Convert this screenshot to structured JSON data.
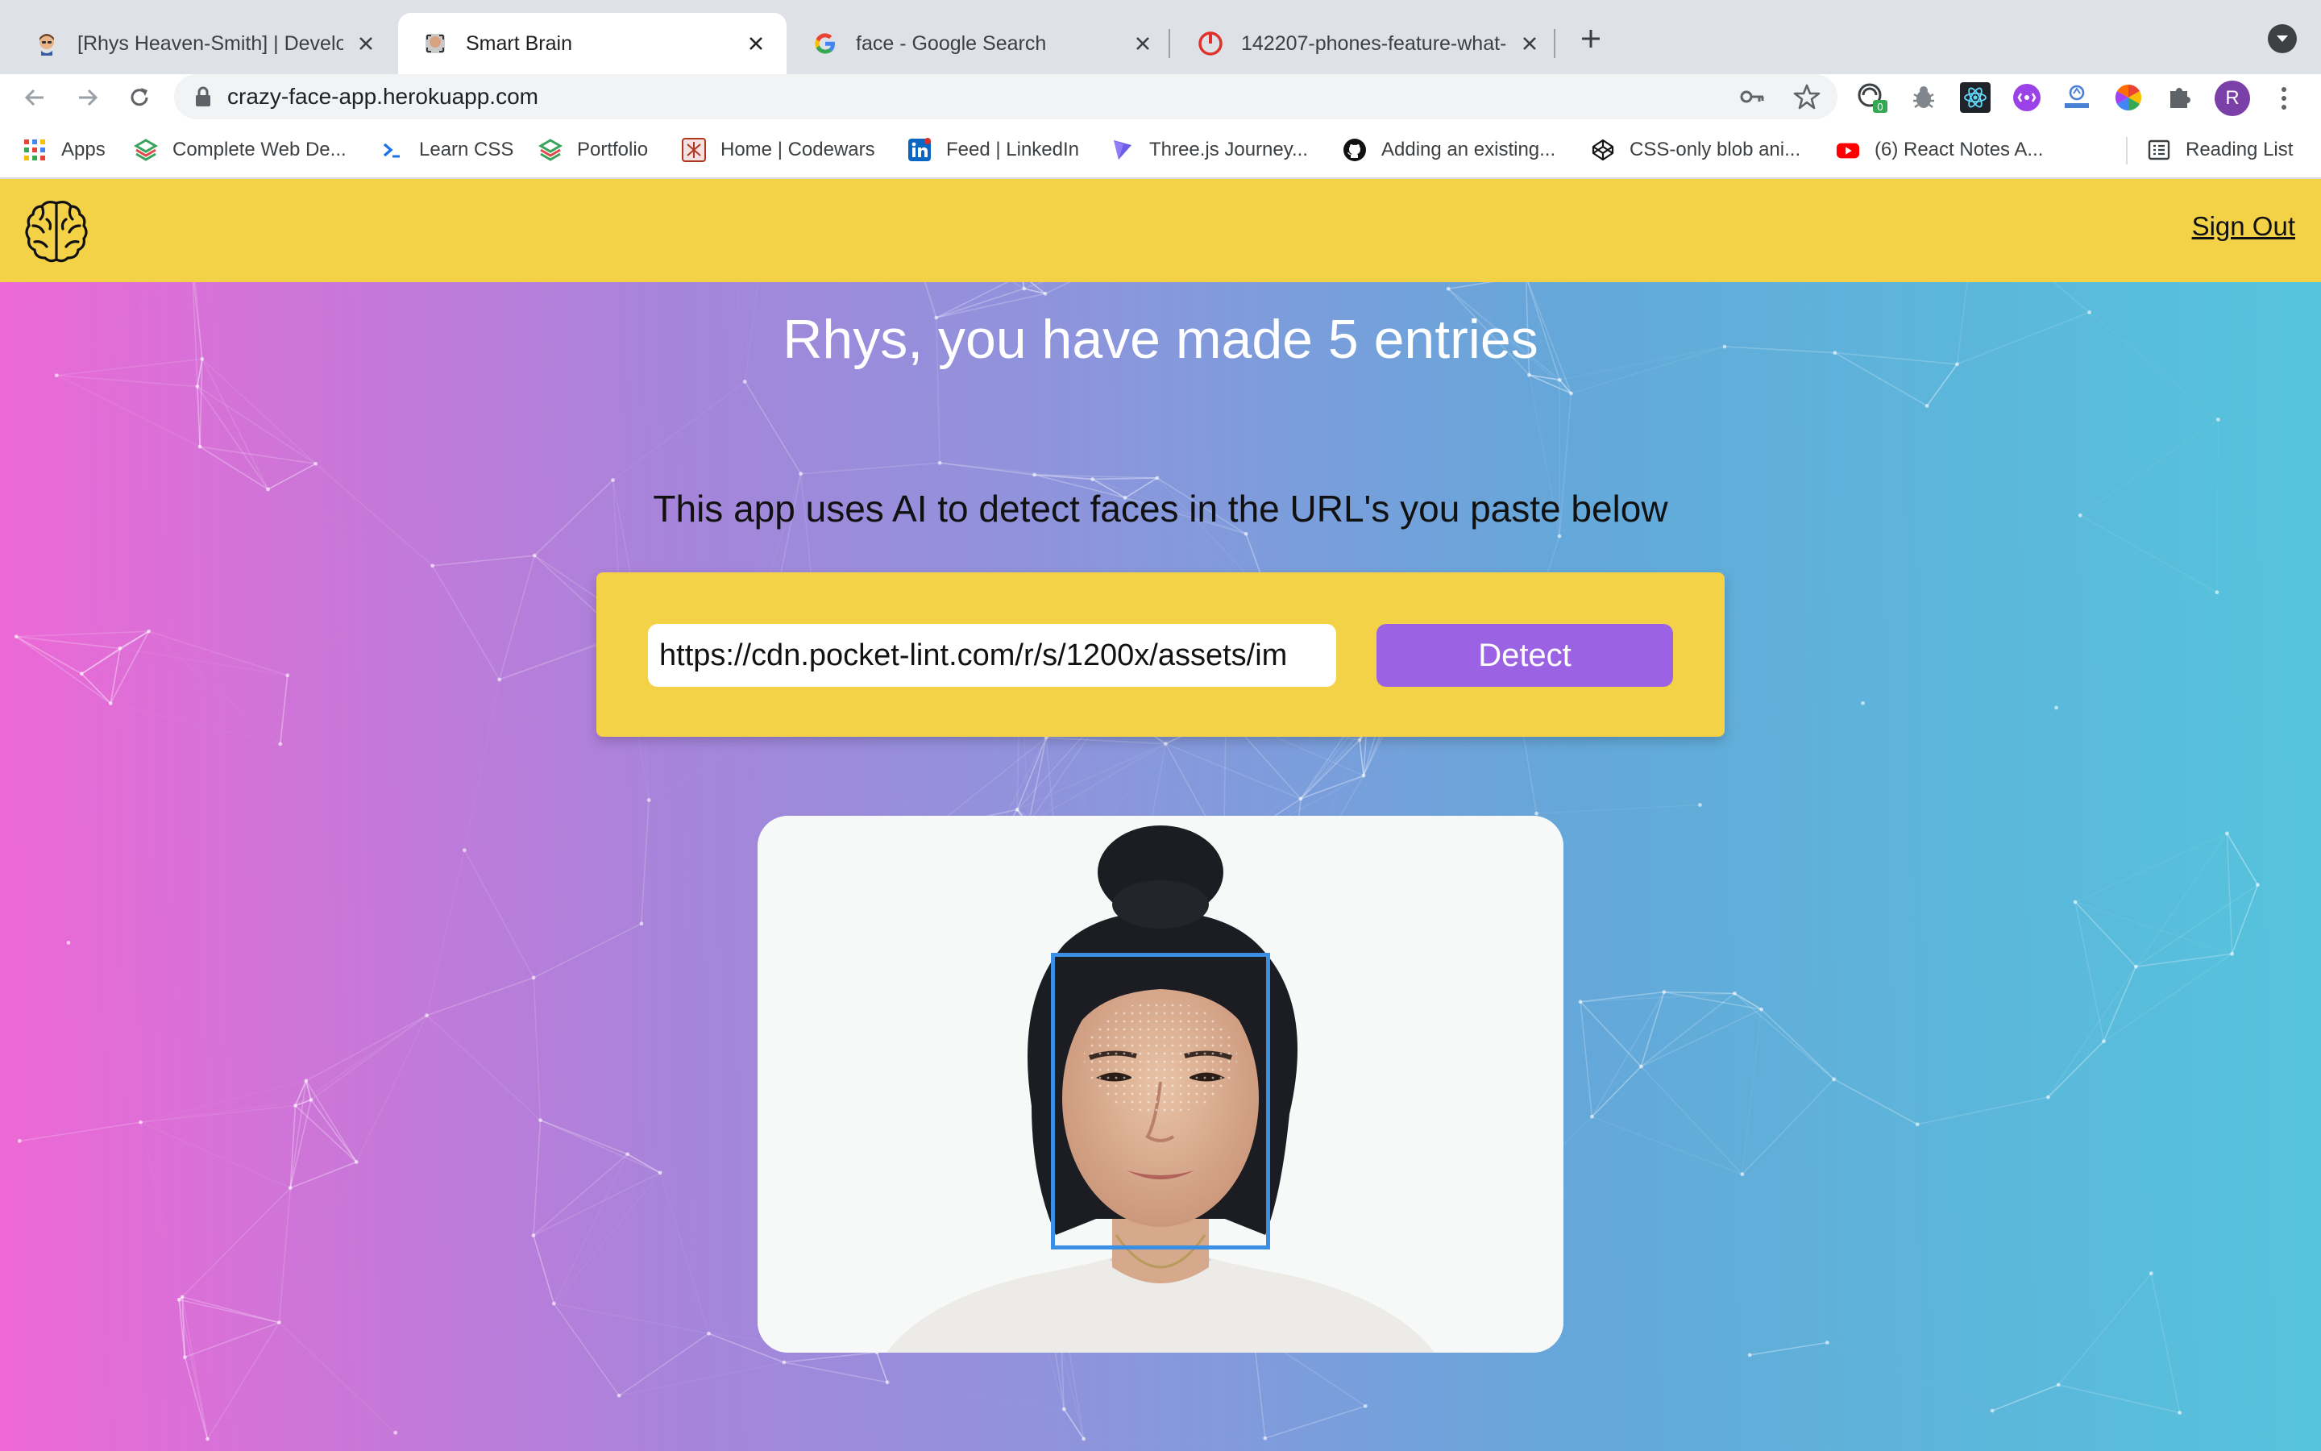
{
  "browser": {
    "tabs": [
      {
        "title": "[Rhys Heaven-Smith] | Develop",
        "active": false
      },
      {
        "title": "Smart Brain",
        "active": true
      },
      {
        "title": "face - Google Search",
        "active": false
      },
      {
        "title": "142207-phones-feature-what-",
        "active": false
      }
    ],
    "url": "crazy-face-app.herokuapp.com",
    "extension_badge": "0",
    "profile_initial": "R",
    "bookmarks": [
      {
        "label": "Apps",
        "icon": "apps-grid-icon"
      },
      {
        "label": "Complete Web De...",
        "icon": "layers-icon"
      },
      {
        "label": "Learn CSS",
        "icon": "terminal-icon"
      },
      {
        "label": "Portfolio",
        "icon": "layers-icon"
      },
      {
        "label": "Home | Codewars",
        "icon": "codewars-icon"
      },
      {
        "label": "Feed | LinkedIn",
        "icon": "linkedin-icon"
      },
      {
        "label": "Three.js Journey...",
        "icon": "threejs-icon"
      },
      {
        "label": "Adding an existing...",
        "icon": "github-icon"
      },
      {
        "label": "CSS-only blob ani...",
        "icon": "codepen-icon"
      },
      {
        "label": "(6) React Notes A...",
        "icon": "youtube-icon"
      }
    ],
    "reading_list": "Reading List"
  },
  "app": {
    "nav": {
      "signout_label": "Sign Out"
    },
    "rank_text": "Rhys, you have made 5 entries",
    "intro_text": "This app uses AI to detect faces in the URL's you paste below",
    "input_value": "https://cdn.pocket-lint.com/r/s/1200x/assets/im",
    "detect_label": "Detect",
    "colors": {
      "navbar": "#f4d248",
      "detect_button": "#9b63e4",
      "face_box": "#3a8fe2",
      "gradient_left": "#ee68d6",
      "gradient_right": "#55c4dc"
    }
  }
}
